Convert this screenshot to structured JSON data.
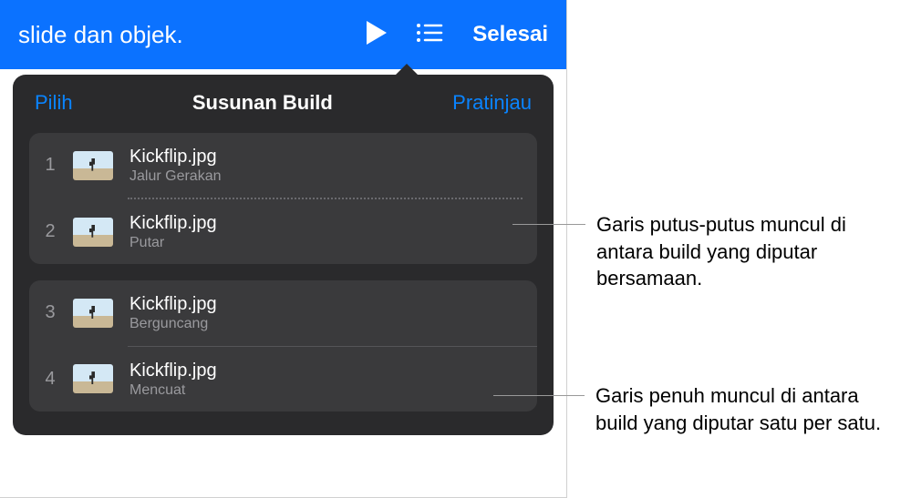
{
  "toolbar": {
    "title_fragment": "slide dan objek.",
    "done_label": "Selesai"
  },
  "popover": {
    "select_label": "Pilih",
    "title": "Susunan Build",
    "preview_label": "Pratinjau"
  },
  "builds": {
    "group1": [
      {
        "index": "1",
        "title": "Kickflip.jpg",
        "effect": "Jalur Gerakan"
      },
      {
        "index": "2",
        "title": "Kickflip.jpg",
        "effect": "Putar"
      }
    ],
    "group2": [
      {
        "index": "3",
        "title": "Kickflip.jpg",
        "effect": "Berguncang"
      },
      {
        "index": "4",
        "title": "Kickflip.jpg",
        "effect": "Mencuat"
      }
    ]
  },
  "callouts": {
    "dotted": "Garis putus-putus muncul di antara build yang diputar bersamaan.",
    "solid": "Garis penuh muncul di antara build yang diputar satu per satu."
  }
}
